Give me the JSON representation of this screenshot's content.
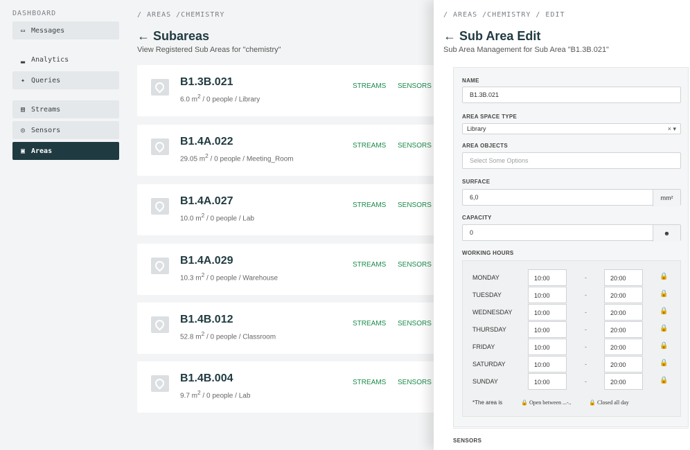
{
  "sidebar": {
    "title": "DASHBOARD",
    "items": [
      {
        "label": "Messages",
        "icon": "inbox-icon"
      },
      {
        "label": "Analytics",
        "icon": "bar-chart-icon"
      },
      {
        "label": "Queries",
        "icon": "puzzle-icon"
      },
      {
        "label": "Streams",
        "icon": "table-icon"
      },
      {
        "label": "Sensors",
        "icon": "target-icon"
      },
      {
        "label": "Areas",
        "icon": "area-icon"
      }
    ],
    "active": "Areas"
  },
  "main": {
    "breadcrumb": "/ AREAS /CHEMISTRY",
    "title": "← Subareas",
    "subtitle": "View Registered Sub Areas for \"chemistry\"",
    "areas": [
      {
        "name": "B1.3B.021",
        "surface": "6.0 m",
        "rest": " / 0 people / Library"
      },
      {
        "name": "B1.4A.022",
        "surface": "29.05 m",
        "rest": " / 0 people / Meeting_Room"
      },
      {
        "name": "B1.4A.027",
        "surface": "10.0 m",
        "rest": " / 0 people / Lab"
      },
      {
        "name": "B1.4A.029",
        "surface": "10.3 m",
        "rest": " / 0 people / Warehouse"
      },
      {
        "name": "B1.4B.012",
        "surface": "52.8 m",
        "rest": " / 0 people / Classroom"
      },
      {
        "name": "B1.4B.004",
        "surface": "9.7 m",
        "rest": " / 0 people / Lab"
      }
    ],
    "streams_label": "STREAMS",
    "sensors_label": "SENSORS",
    "sup": "2"
  },
  "panel": {
    "breadcrumb": "/ AREAS /CHEMISTRY / EDIT",
    "title": "← Sub Area Edit",
    "subtitle": "Sub Area Management for Sub Area \"B1.3B.021\"",
    "name_label": "NAME",
    "name_value": "B1.3B.021",
    "space_type_label": "AREA SPACE TYPE",
    "space_type_value": "Library",
    "space_type_clear": "×",
    "space_type_arrow": "▾",
    "objects_label": "AREA OBJECTS",
    "objects_placeholder": "Select Some Options",
    "surface_label": "SURFACE",
    "surface_value": "6,0",
    "surface_unit": "mm²",
    "capacity_label": "CAPACITY",
    "capacity_value": "0",
    "working_hours_label": "WORKING HOURS",
    "days": [
      {
        "day": "MONDAY",
        "from": "10:00",
        "to": "20:00"
      },
      {
        "day": "TUESDAY",
        "from": "10:00",
        "to": "20:00"
      },
      {
        "day": "WEDNESDAY",
        "from": "10:00",
        "to": "20:00"
      },
      {
        "day": "THURSDAY",
        "from": "10:00",
        "to": "20:00"
      },
      {
        "day": "FRIDAY",
        "from": "10:00",
        "to": "20:00"
      },
      {
        "day": "SATURDAY",
        "from": "10:00",
        "to": "20:00"
      },
      {
        "day": "SUNDAY",
        "from": "10:00",
        "to": "20:00"
      }
    ],
    "dash": "-",
    "legend_prefix": "*The area is",
    "legend_open": "Open between ...-..",
    "legend_closed": "Closed all day",
    "sensors_label": "SENSORS"
  }
}
